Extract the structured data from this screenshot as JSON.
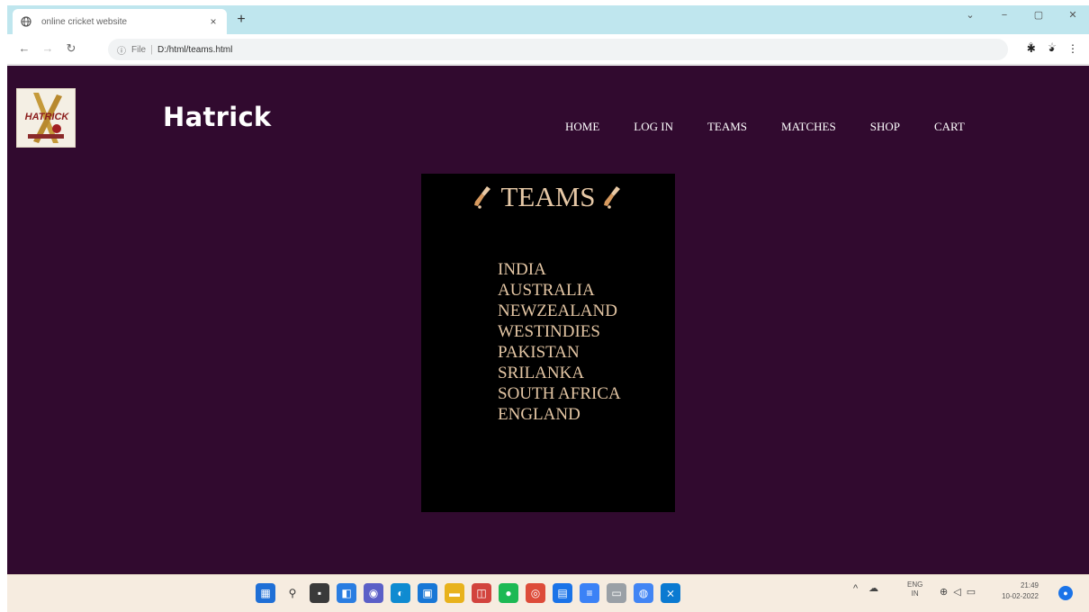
{
  "browser": {
    "tab_title": "online cricket website",
    "tab_close": "×",
    "new_tab": "+",
    "url_prefix": "File",
    "url": "D:/html/teams.html",
    "window_controls": [
      "⌄",
      "−",
      "▢",
      "✕"
    ]
  },
  "header": {
    "brand": "Hatrick",
    "logo_text": "HATRICK",
    "nav": [
      "HOME",
      "LOG IN",
      "TEAMS",
      "MATCHES",
      "SHOP",
      "CART"
    ]
  },
  "teams": {
    "title": "TEAMS",
    "list": [
      "INDIA",
      "AUSTRALIA",
      "NEWZEALAND",
      "WESTINDIES",
      "PAKISTAN",
      "SRILANKA",
      "SOUTH AFRICA",
      "ENGLAND"
    ]
  },
  "taskbar": {
    "lang_line1": "ENG",
    "lang_line2": "IN",
    "time": "21:49",
    "date": "10-02-2022"
  },
  "colors": {
    "page_bg": "#310a2f",
    "panel_bg": "#000000",
    "team_text": "#e4c6a4",
    "tabbar_bg": "#bfe6ee"
  },
  "icons": {
    "bat": "cricket-bat-icon",
    "tab_favicon": "globe-icon",
    "back": "back-arrow-icon",
    "forward": "forward-arrow-icon",
    "reload": "reload-icon",
    "info": "info-icon",
    "share": "share-icon",
    "bookmark": "star-icon",
    "extensions": "puzzle-icon",
    "profile": "avatar-icon",
    "menu": "kebab-menu-icon"
  }
}
